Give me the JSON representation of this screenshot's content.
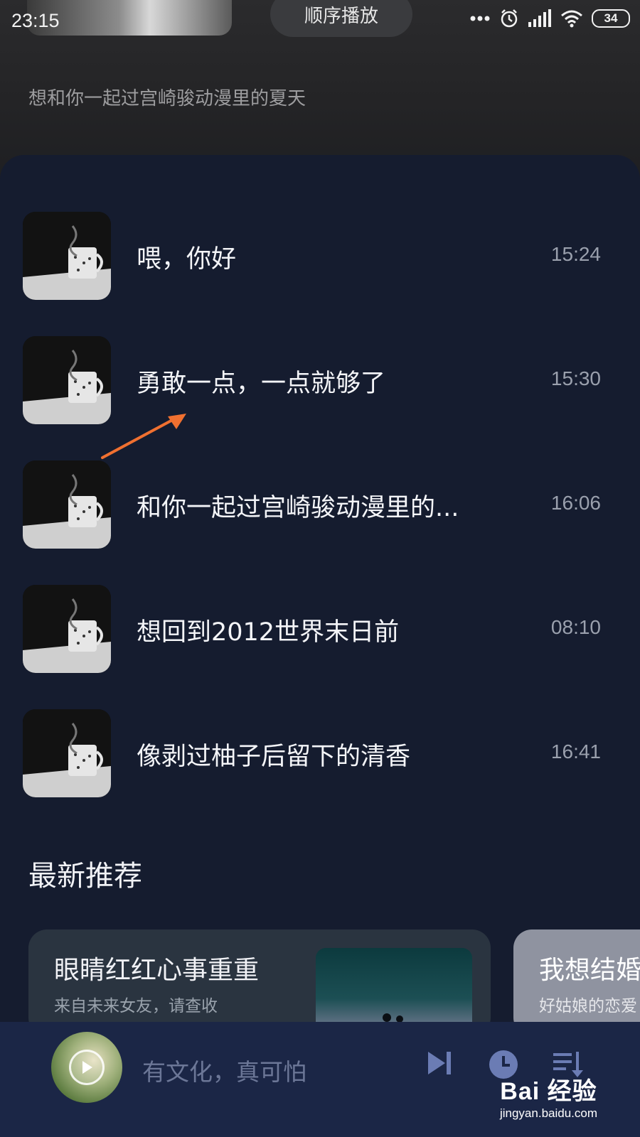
{
  "status_bar": {
    "time": "23:15",
    "battery": "34",
    "icons": [
      "more-dots-icon",
      "alarm-icon",
      "signal-icon",
      "wifi-icon",
      "battery-icon"
    ]
  },
  "header": {
    "play_mode": "顺序播放",
    "subtitle": "想和你一起过宫崎骏动漫里的夏天"
  },
  "playlist": [
    {
      "title": "喂，你好",
      "time": "15:24"
    },
    {
      "title": "勇敢一点，一点就够了",
      "time": "15:30"
    },
    {
      "title": "和你一起过宫崎骏动漫里的...",
      "time": "16:06"
    },
    {
      "title": "想回到2012世界末日前",
      "time": "08:10"
    },
    {
      "title": "像剥过柚子后留下的清香",
      "time": "16:41"
    }
  ],
  "recommend": {
    "section_title": "最新推荐",
    "cards": [
      {
        "title": "眼睛红红心事重重",
        "subtitle": "来自未来女友，请查收"
      },
      {
        "title": "我想结婚",
        "subtitle": "好姑娘的恋爱"
      }
    ]
  },
  "player": {
    "now_playing": "有文化，真可怕",
    "controls": [
      "next-icon",
      "timer-icon",
      "playlist-icon"
    ]
  },
  "watermark": {
    "brand": "Bai 经验",
    "url": "jingyan.baidu.com"
  },
  "colors": {
    "panel_bg": "#151c2f",
    "player_bg": "#1b2646",
    "annotation_arrow": "#f07030"
  }
}
